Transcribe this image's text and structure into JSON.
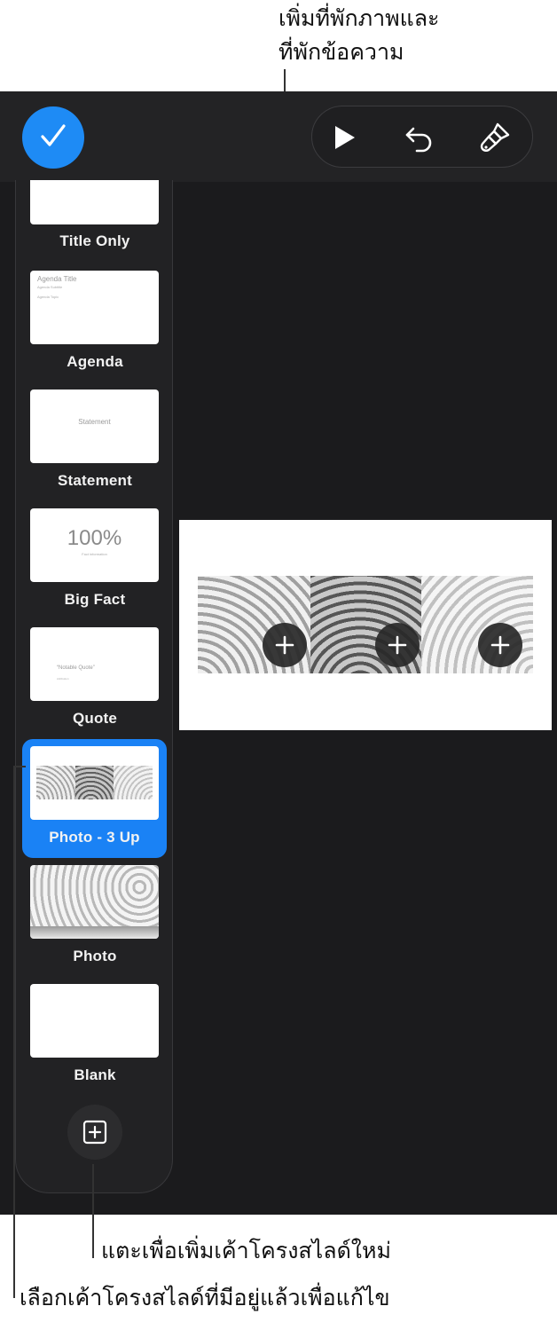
{
  "callouts": {
    "top_line1": "เพิ่มที่พักภาพและ",
    "top_line2": "ที่พักข้อความ",
    "add_layout": "แตะเพื่อเพิ่มเค้าโครงสไลด์ใหม่",
    "choose_layout": "เลือกเค้าโครงสไลด์ที่มีอยู่แล้วเพื่อแก้ไข"
  },
  "toolbar": {
    "done_icon": "checkmark-icon",
    "play_icon": "play-icon",
    "undo_icon": "undo-icon",
    "format_icon": "paintbrush-icon"
  },
  "layouts": [
    {
      "label": "Title Only"
    },
    {
      "label": "Agenda",
      "thumb_title": "Agenda Title",
      "thumb_sub": "Agenda Subtitle",
      "thumb_body": "Agenda Topic"
    },
    {
      "label": "Statement",
      "thumb_text": "Statement"
    },
    {
      "label": "Big Fact",
      "thumb_big": "100%",
      "thumb_small": "Fact information"
    },
    {
      "label": "Quote",
      "thumb_quote": "“Notable Quote”",
      "thumb_attr": "Attribution"
    },
    {
      "label": "Photo - 3 Up",
      "selected": true
    },
    {
      "label": "Photo"
    },
    {
      "label": "Blank"
    }
  ],
  "colors": {
    "accent": "#1a82f5",
    "background": "#1b1b1d",
    "panel": "#222224"
  }
}
